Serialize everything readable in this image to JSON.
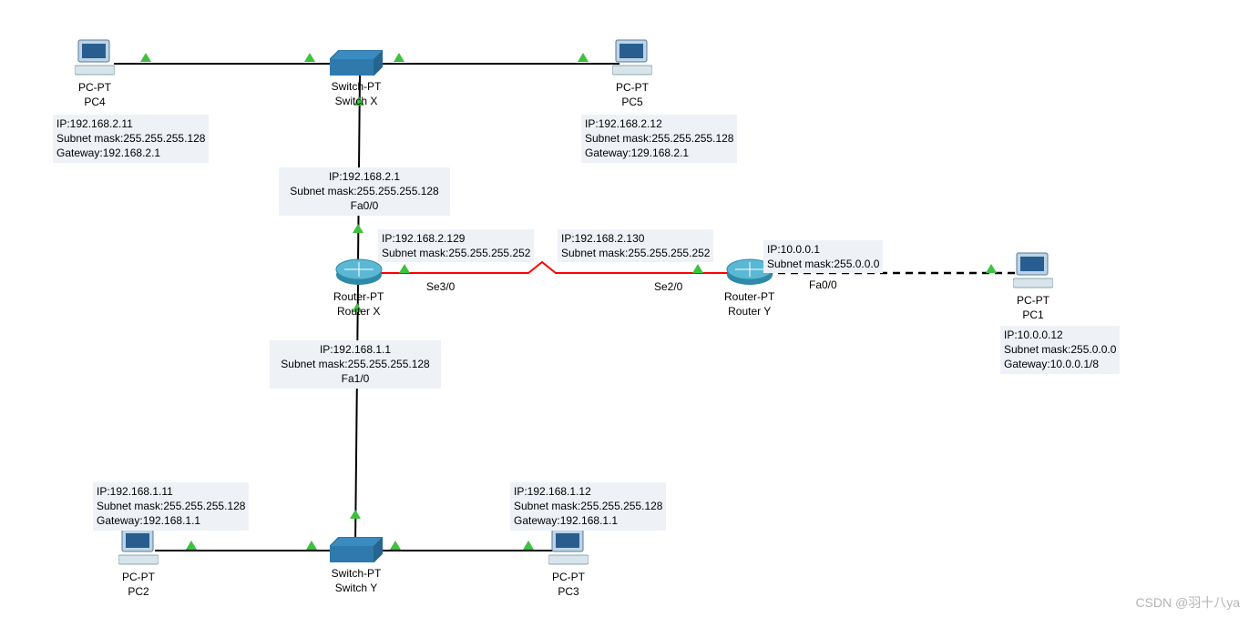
{
  "devices": {
    "pc4": {
      "type": "PC-PT",
      "name": "PC4"
    },
    "pc5": {
      "type": "PC-PT",
      "name": "PC5"
    },
    "pc1": {
      "type": "PC-PT",
      "name": "PC1"
    },
    "pc2": {
      "type": "PC-PT",
      "name": "PC2"
    },
    "pc3": {
      "type": "PC-PT",
      "name": "PC3"
    },
    "switchX": {
      "type": "Switch-PT",
      "name": "Switch X"
    },
    "switchY": {
      "type": "Switch-PT",
      "name": "Switch Y"
    },
    "routerX": {
      "type": "Router-PT",
      "name": "Router X"
    },
    "routerY": {
      "type": "Router-PT",
      "name": "Router Y"
    }
  },
  "configs": {
    "pc4": {
      "ip": "IP:192.168.2.11",
      "mask": "Subnet mask:255.255.255.128",
      "gw": "Gateway:192.168.2.1"
    },
    "pc5": {
      "ip": "IP:192.168.2.12",
      "mask": "Subnet mask:255.255.255.128",
      "gw": "Gateway:129.168.2.1"
    },
    "pc2": {
      "ip": "IP:192.168.1.11",
      "mask": "Subnet mask:255.255.255.128",
      "gw": "Gateway:192.168.1.1"
    },
    "pc3": {
      "ip": "IP:192.168.1.12",
      "mask": "Subnet mask:255.255.255.128",
      "gw": "Gateway:192.168.1.1"
    },
    "pc1": {
      "ip": "IP:10.0.0.12",
      "mask": "Subnet mask:255.0.0.0",
      "gw": "Gateway:10.0.0.1/8"
    },
    "rx_fa00": {
      "ip": "IP:192.168.2.1",
      "mask": "Subnet mask:255.255.255.128",
      "if": "Fa0/0"
    },
    "rx_fa10": {
      "ip": "IP:192.168.1.1",
      "mask": "Subnet mask:255.255.255.128",
      "if": "Fa1/0"
    },
    "rx_se30": {
      "ip": "IP:192.168.2.129",
      "mask": "Subnet mask:255.255.255.252",
      "if": "Se3/0"
    },
    "ry_se20": {
      "ip": "IP:192.168.2.130",
      "mask": "Subnet mask:255.255.255.252",
      "if": "Se2/0"
    },
    "ry_fa00": {
      "ip": "IP:10.0.0.1",
      "mask": "Subnet mask:255.0.0.0",
      "if": "Fa0/0"
    }
  },
  "watermark": "CSDN @羽十八ya"
}
